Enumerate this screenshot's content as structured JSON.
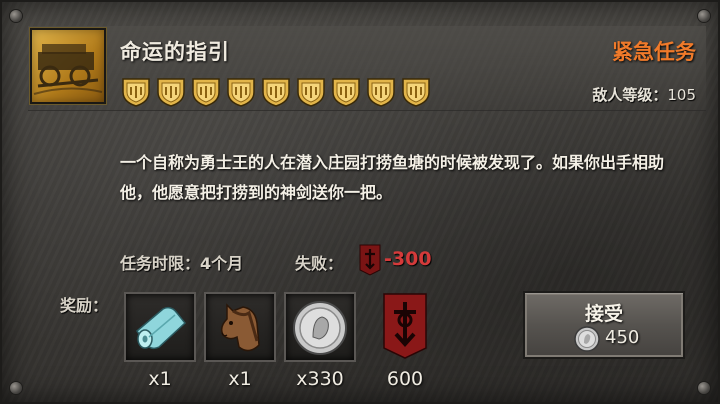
{
  "quest": {
    "title": "命运的指引",
    "type_label": "紧急任务",
    "enemy_level_label": "敌人等级：",
    "enemy_level_value": "105",
    "difficulty_shields": 9,
    "description": "一个自称为勇士王的人在潜入庄园打捞鱼塘的时候被发现了。如果你出手相助他，他愿意把打捞到的神剑送你一把。",
    "time_limit": "任务时限：4个月",
    "fail_label": "失败：",
    "fail_value": "-300"
  },
  "rewards": {
    "label": "奖励：",
    "items": [
      {
        "icon": "cloth-roll-icon",
        "qty": "x1"
      },
      {
        "icon": "horse-icon",
        "qty": "x1"
      },
      {
        "icon": "silver-coin-icon",
        "qty": "x330"
      },
      {
        "icon": "reputation-banner-icon",
        "qty": "600"
      }
    ]
  },
  "accept_button": {
    "label": "接受",
    "cost": "450",
    "cost_icon": "silver-coin-icon"
  },
  "colors": {
    "urgent": "#f07a2a",
    "fail": "#d53a3a",
    "shield_gold": "#e2b54a"
  }
}
